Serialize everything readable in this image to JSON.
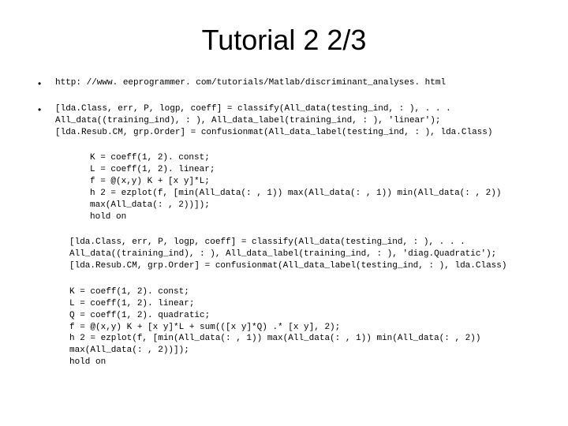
{
  "title": "Tutorial 2 2/3",
  "bullet1": "http: //www. eeprogrammer. com/tutorials/Matlab/discriminant_analyses. html",
  "bullet2": "[lda.Class, err, P, logp, coeff] = classify(All_data(testing_ind, : ), . . .\nAll_data((training_ind), : ), All_data_label(training_ind, : ), 'linear');\n[lda.Resub.CM, grp.Order] = confusionmat(All_data_label(testing_ind, : ), lda.Class)",
  "block1": "K = coeff(1, 2). const;\nL = coeff(1, 2). linear;\nf = @(x,y) K + [x y]*L;\nh 2 = ezplot(f, [min(All_data(: , 1)) max(All_data(: , 1)) min(All_data(: , 2))\nmax(All_data(: , 2))]);\nhold on",
  "block2": "[lda.Class, err, P, logp, coeff] = classify(All_data(testing_ind, : ), . . .\nAll_data((training_ind), : ), All_data_label(training_ind, : ), 'diag.Quadratic');\n[lda.Resub.CM, grp.Order] = confusionmat(All_data_label(testing_ind, : ), lda.Class)",
  "block3": "K = coeff(1, 2). const;\nL = coeff(1, 2). linear;\nQ = coeff(1, 2). quadratic;\nf = @(x,y) K + [x y]*L + sum(([x y]*Q) .* [x y], 2);\nh 2 = ezplot(f, [min(All_data(: , 1)) max(All_data(: , 1)) min(All_data(: , 2))\nmax(All_data(: , 2))]);\nhold on"
}
